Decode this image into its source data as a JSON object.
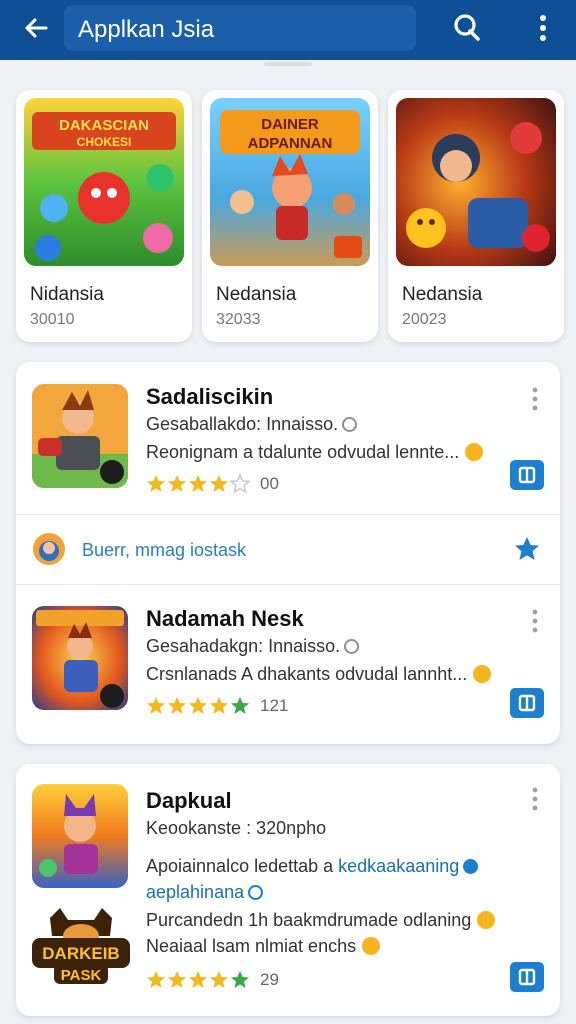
{
  "appbar": {
    "title": "Applkan Jsia"
  },
  "top_apps": [
    {
      "name": "Nidansia",
      "count": "30010",
      "banner": "DAKASCIAN\nCHOKESI"
    },
    {
      "name": "Nedansia",
      "count": "32033",
      "banner": "DAINER\nADPANNAN"
    },
    {
      "name": "Nedansia",
      "count": "20023",
      "banner": ""
    }
  ],
  "list": [
    {
      "title": "Sadaliscikin",
      "line1": "Gesaballakdo: Innaisso.",
      "line2": "Reonignam a tdalunte odvudal lennte...",
      "rating": 4,
      "rating_text": "00"
    },
    {
      "title": "Nadamah Nesk",
      "line1": "Gesahadakgn: Innaisso.",
      "line2": "Crsnlanads A dhakants odvudal lannht...",
      "rating": 5,
      "rating_text": "121"
    }
  ],
  "promo": {
    "text": "Buerr, mmag iostask"
  },
  "detail": {
    "title": "Dapkual",
    "line1": "Keookanste : 320npho",
    "line2a": "Apoiainnalco ledettab a ",
    "line2_link": "kedkaakaaning",
    "line3": "aeplahinana",
    "line4": "Purcandedn 1h baakmdrumade odlaning",
    "line5": "Neaiaal lsam nlmiat enchs",
    "rating": 5,
    "rating_text": "29",
    "logo_text": "DARKEIB\nPASK"
  },
  "colors": {
    "appbar": "#0e4f96",
    "accent": "#1c7fd0",
    "star": "#f5b81c",
    "star_green": "#3aa64a"
  },
  "icons": [
    "arrow-left-icon",
    "search-icon",
    "more-vert-icon",
    "star-icon",
    "external-link-icon",
    "star-filled-icon"
  ]
}
